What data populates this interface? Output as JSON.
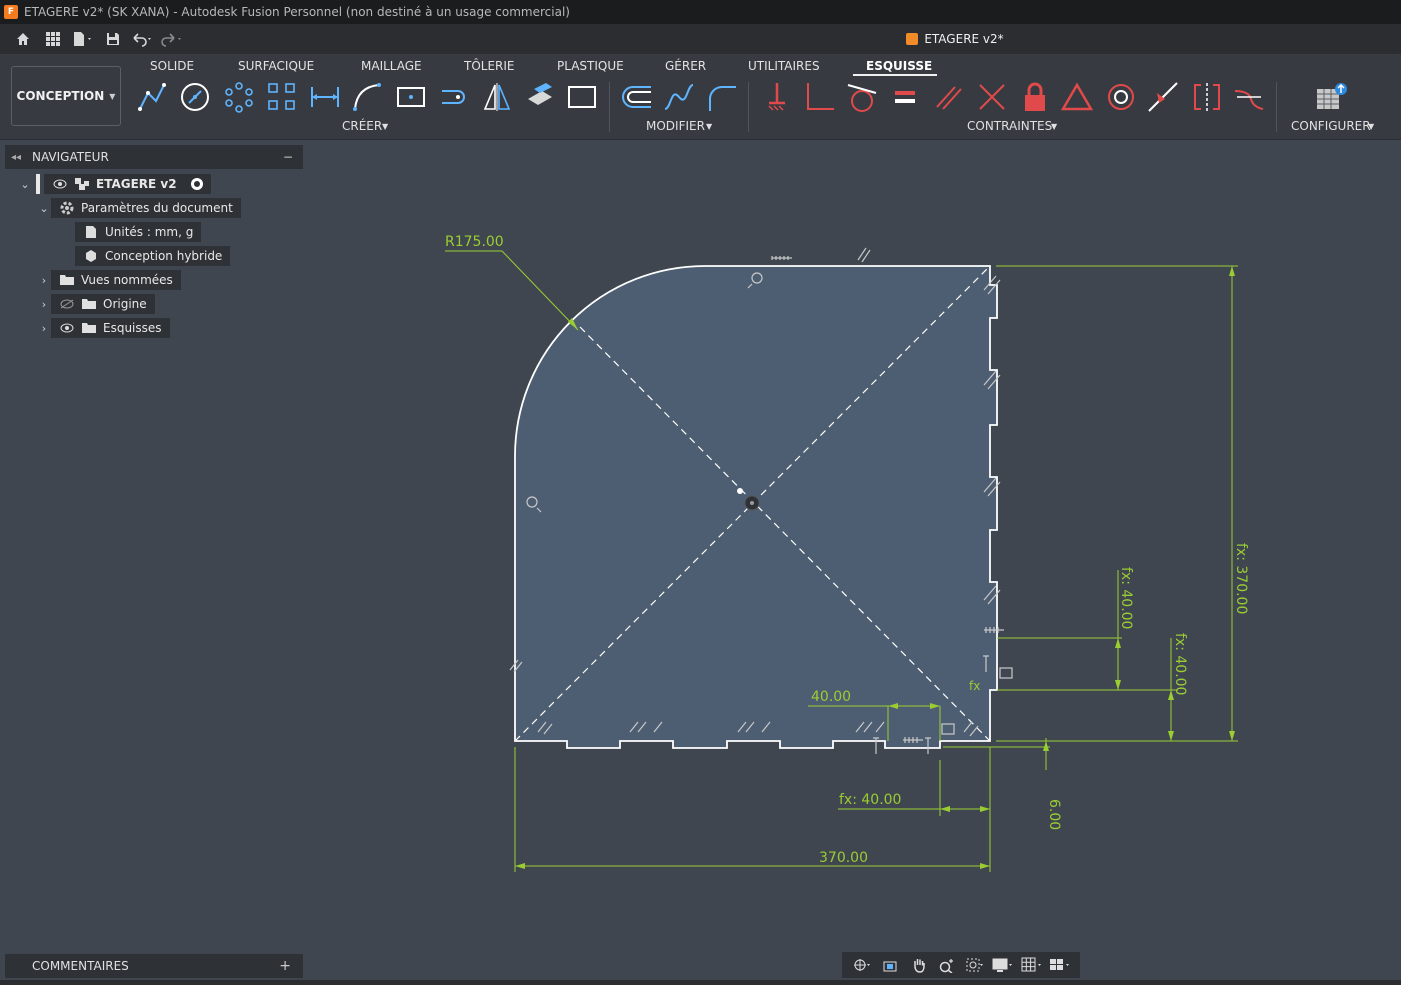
{
  "window": {
    "title": "ETAGERE v2* (SK XANA) - Autodesk Fusion Personnel (non destiné à un usage commercial)"
  },
  "document_tab": {
    "label": "ETAGERE v2*"
  },
  "workspace": {
    "label": "CONCEPTION"
  },
  "ribbon": {
    "tabs": [
      {
        "label": "SOLIDE"
      },
      {
        "label": "SURFACIQUE"
      },
      {
        "label": "MAILLAGE"
      },
      {
        "label": "TÔLERIE"
      },
      {
        "label": "PLASTIQUE"
      },
      {
        "label": "GÉRER"
      },
      {
        "label": "UTILITAIRES"
      },
      {
        "label": "ESQUISSE"
      }
    ],
    "active_tab": "ESQUISSE",
    "groups": [
      {
        "label": "CRÉER"
      },
      {
        "label": "MODIFIER"
      },
      {
        "label": "CONTRAINTES"
      },
      {
        "label": "CONFIGURER"
      }
    ]
  },
  "navigator": {
    "title": "NAVIGATEUR",
    "root": {
      "label": "ETAGERE v2"
    },
    "items": [
      {
        "label": "Paramètres du document"
      },
      {
        "label": "Unités : mm, g"
      },
      {
        "label": "Conception hybride"
      },
      {
        "label": "Vues nommées"
      },
      {
        "label": "Origine"
      },
      {
        "label": "Esquisses"
      }
    ]
  },
  "comments": {
    "title": "COMMENTAIRES"
  },
  "sketch": {
    "dimensions": {
      "radius": "R175.00",
      "height_total": "fx: 370.00",
      "width_total": "370.00",
      "tab_offset_right_1": "fx: 40.00",
      "tab_offset_right_2": "fx: 40.00",
      "tab_width_bottom": "40.00",
      "tab_offset_bottom": "fx: 40.00",
      "slot_depth": "6.00",
      "fx_label": "fx"
    }
  },
  "colors": {
    "background": "#3f4650",
    "sketch_fill": "#4e5e72",
    "dimension": "#9acd32",
    "sketch_line": "#ffffff",
    "accent": "#f28c28"
  }
}
